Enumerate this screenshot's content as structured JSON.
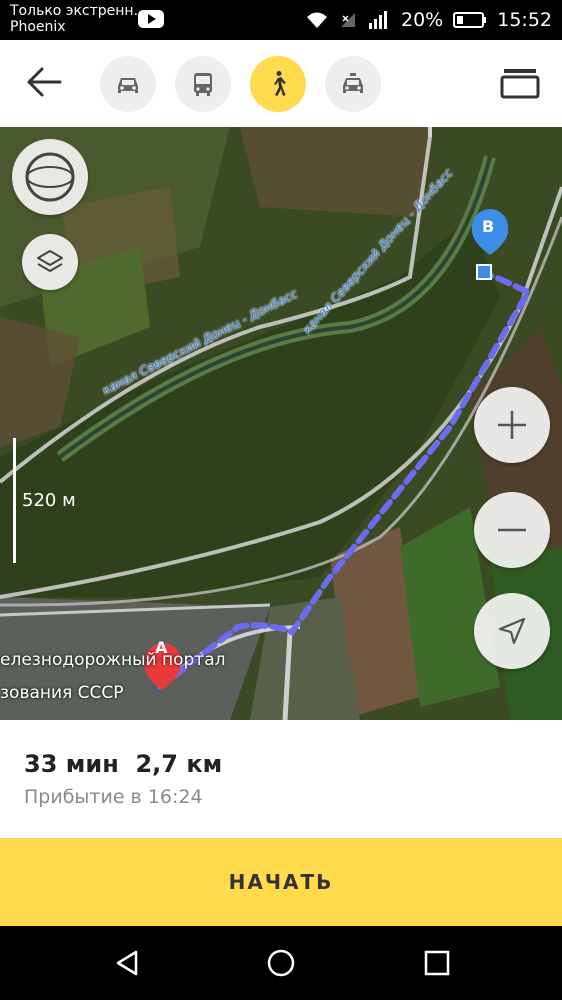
{
  "status_bar": {
    "notice_line1": "Только экстренн...",
    "notice_line2": "Phoenix",
    "battery_percent": "20%",
    "time": "15:52"
  },
  "transport_modes": [
    {
      "name": "car",
      "active": false
    },
    {
      "name": "public-transport",
      "active": false
    },
    {
      "name": "walking",
      "active": true
    },
    {
      "name": "taxi",
      "active": false
    }
  ],
  "map": {
    "scale": "520 м",
    "canal_label": "канал Северский Донец - Донбасс",
    "point_a": "A",
    "point_b": "B",
    "label_street": "елезнодорожный портал",
    "label_street2": "зования СССР"
  },
  "route": {
    "summary": "33 мин  2,7 км",
    "arrival": "Прибытие в 16:24",
    "accent_color": "#6c6cf0"
  },
  "start_button": "НАЧАТЬ"
}
